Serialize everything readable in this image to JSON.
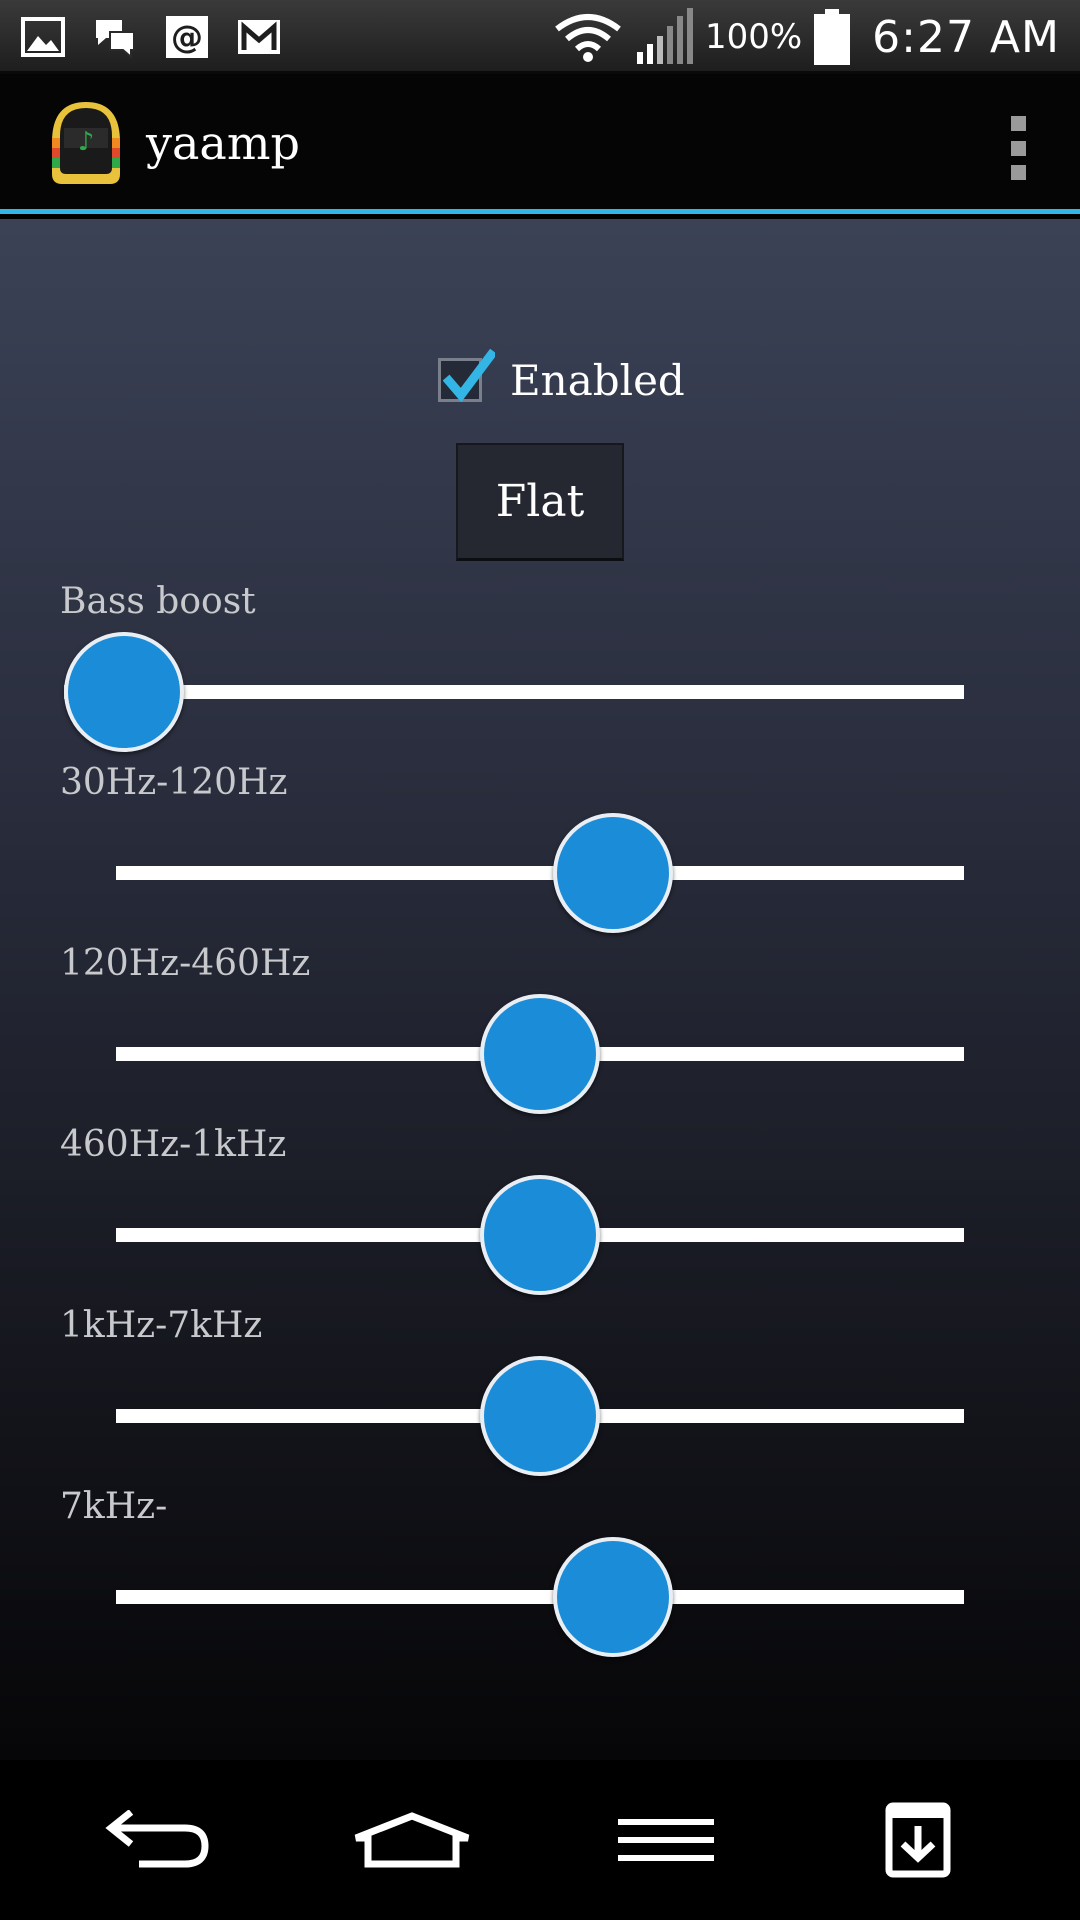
{
  "status_bar": {
    "left_icons": [
      "gallery-icon",
      "messaging-icon",
      "email-icon",
      "gmail-icon"
    ],
    "battery_percent": "100%",
    "time": "6:27 AM"
  },
  "action_bar": {
    "title": "yaamp",
    "app_icon": "daft-punk-helmet-icon",
    "overflow_icon": "overflow-menu-icon",
    "accent_color": "#33b5e5"
  },
  "equalizer": {
    "enabled_label": "Enabled",
    "enabled_checked": true,
    "preset_button_label": "Flat",
    "bass_boost": {
      "label": "Bass boost",
      "value_fraction": 0.0
    },
    "bands": [
      {
        "label": "30Hz-120Hz",
        "value_fraction": 0.6
      },
      {
        "label": "120Hz-460Hz",
        "value_fraction": 0.5
      },
      {
        "label": "460Hz-1kHz",
        "value_fraction": 0.5
      },
      {
        "label": "1kHz-7kHz",
        "value_fraction": 0.5
      },
      {
        "label": "7kHz-",
        "value_fraction": 0.6
      }
    ],
    "slider_color": "#1b8cd8"
  },
  "nav_bar": {
    "buttons": [
      "back-icon",
      "home-icon",
      "menu-icon",
      "download-icon"
    ]
  }
}
